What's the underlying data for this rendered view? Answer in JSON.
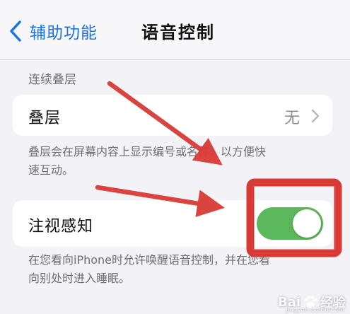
{
  "nav": {
    "back_label": "辅助功能",
    "title": "语音控制"
  },
  "section": {
    "header": "连续叠层"
  },
  "overlay_row": {
    "label": "叠层",
    "value": "无",
    "footer_line1": "叠层会在屏幕内容上显示编号或名称，以方便快",
    "footer_line2": "速互动。"
  },
  "attention_row": {
    "label": "注视感知",
    "toggle_on": true,
    "footer_line1": "在您看向iPhone时允许唤醒语音控制，并在您看",
    "footer_line2": "向别处时进入睡眠。"
  },
  "colors": {
    "accent": "#1a73e8",
    "toggle_on": "#5cb85c",
    "annotation_red": "#d93a36"
  },
  "icons": {
    "back": "chevron-left-icon",
    "disclosure": "chevron-right-icon"
  },
  "watermark": {
    "logo_text_left": "Bai",
    "logo_text_right": "经验",
    "sub": "jingyan.baidu.com"
  }
}
